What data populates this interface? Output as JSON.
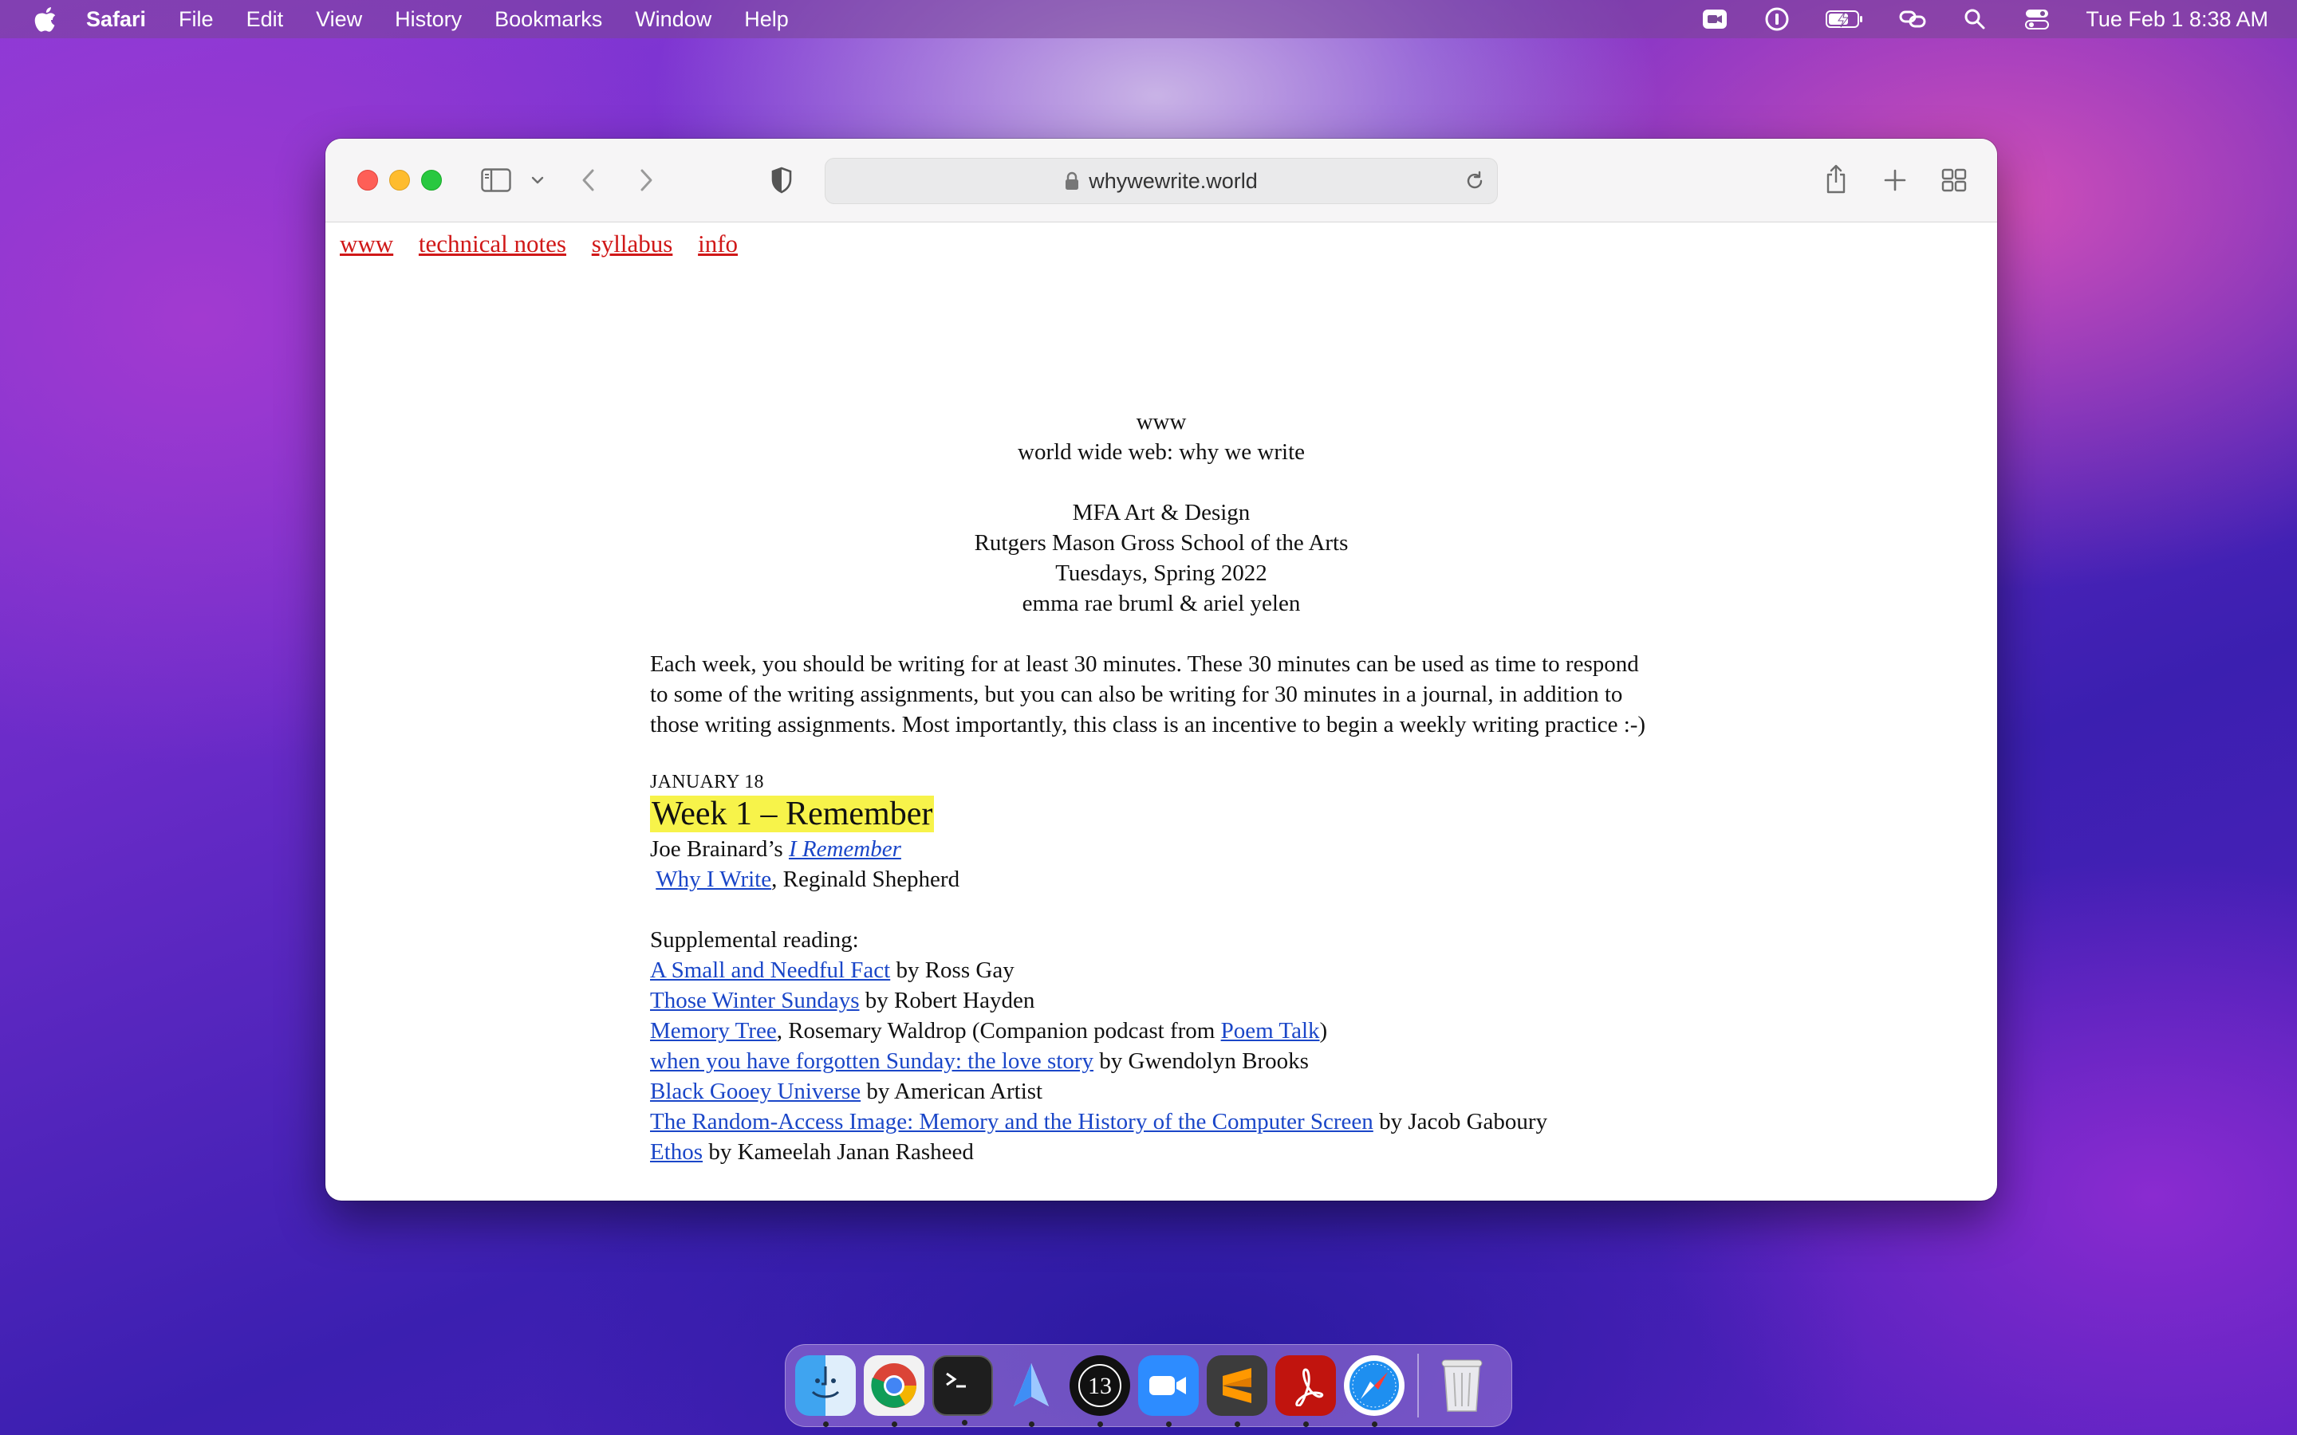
{
  "menubar": {
    "app_name": "Safari",
    "menus": [
      "File",
      "Edit",
      "View",
      "History",
      "Bookmarks",
      "Window",
      "Help"
    ],
    "clock": "Tue Feb 1  8:38 AM",
    "status_icons": [
      "facetime-video-icon",
      "onepassword-icon",
      "battery-charging-icon",
      "link-icon",
      "spotlight-search-icon",
      "control-center-icon"
    ]
  },
  "browser": {
    "url": "whywewrite.world",
    "colors": {
      "close": "#fe5f57",
      "minimize": "#febc2e",
      "zoom": "#28c840"
    }
  },
  "page": {
    "nav": [
      "www",
      "technical notes",
      "syllabus",
      "info"
    ],
    "intro": {
      "line1": "www",
      "line2": "world wide web: why we write",
      "line3": "MFA Art & Design",
      "line4": "Rutgers Mason Gross School of the Arts",
      "line5": "Tuesdays, Spring 2022",
      "line6": "emma rae bruml & ariel yelen"
    },
    "paragraph": "Each week, you should be writing for at least 30 minutes. These 30 minutes can be used as time to respond to some of the writing assignments, but you can also be writing for 30 minutes in a journal, in addition to those writing assignments. Most importantly, this class is an incentive to begin a weekly writing practice :-)",
    "date": "JANUARY 18",
    "week_title": "Week 1 – Remember",
    "reading1_prefix": "Joe Brainard’s ",
    "reading1_link": "I Remember",
    "reading2_link": "Why I Write",
    "reading2_suffix": ", Reginald Shepherd",
    "supplemental_label": "Supplemental reading:",
    "supplemental": [
      {
        "link": "A Small and Needful Fact",
        "suffix": " by Ross Gay"
      },
      {
        "link": "Those Winter Sundays",
        "suffix": " by Robert Hayden"
      },
      {
        "link": "Memory Tree",
        "suffix": ", Rosemary Waldrop (Companion podcast from ",
        "link2": "Poem Talk",
        "suffix2": ")"
      },
      {
        "link": "when you have forgotten Sunday: the love story",
        "suffix": " by Gwendolyn Brooks"
      },
      {
        "link": "Black Gooey Universe",
        "suffix": " by American Artist"
      },
      {
        "link": "The Random-Access Image: Memory and the History of the Computer Screen",
        "suffix": " by Jacob Gaboury"
      },
      {
        "link": "Ethos",
        "suffix": " by Kameelah Janan Rasheed"
      }
    ],
    "colors": {
      "nav_link": "#d01818",
      "link": "#1a46c8",
      "highlight": "#f7f34a"
    }
  },
  "dock": {
    "apps": [
      "finder-icon",
      "chrome-icon",
      "terminal-icon",
      "spark-icon",
      "thirteen-icon",
      "zoom-icon",
      "sublime-text-icon",
      "acrobat-icon",
      "safari-icon"
    ],
    "trash": "trash-icon"
  }
}
